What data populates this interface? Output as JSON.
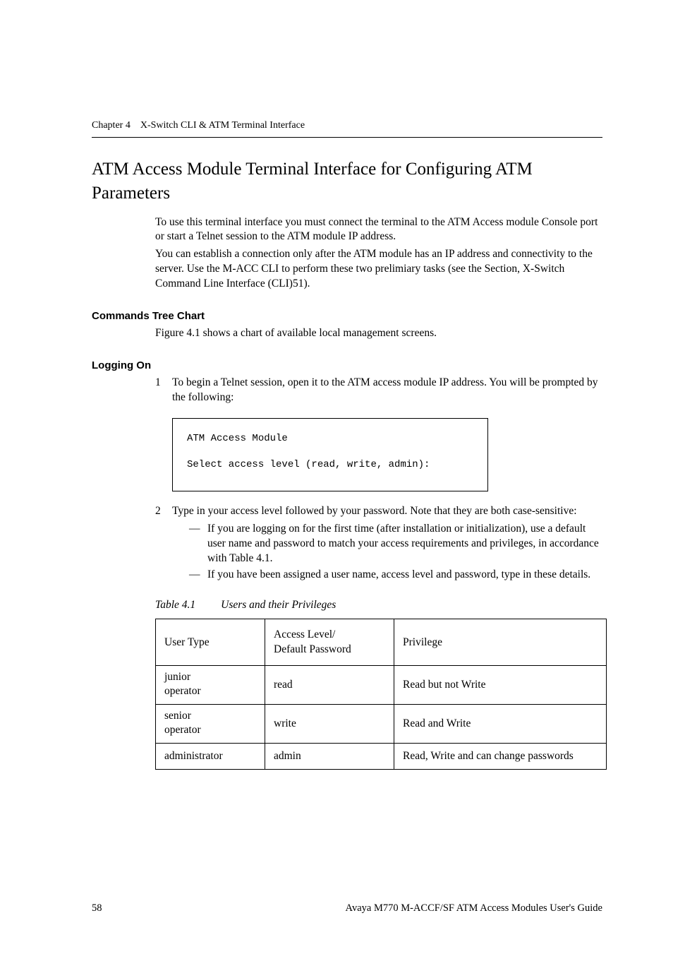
{
  "running_head": {
    "chapter": "Chapter 4",
    "title": "X-Switch CLI & ATM Terminal Interface"
  },
  "section_title": "ATM Access Module Terminal Interface for Configuring ATM Parameters",
  "intro": {
    "p1": "To use this terminal interface you must connect the terminal to the ATM Access module Console port or start a Telnet session to the ATM module IP address.",
    "p2": "You can establish a connection only after the ATM module has an IP address and connectivity to the server. Use the M-ACC CLI to perform these two prelimiary tasks (see the Section, X-Switch Command Line Interface (CLI)51)."
  },
  "commands_tree": {
    "heading": "Commands Tree Chart",
    "text": "Figure 4.1 shows a chart of available local management screens."
  },
  "logging_on": {
    "heading": "Logging On",
    "steps": [
      {
        "num": "1",
        "text": "To begin a Telnet session, open it to the ATM access module IP address. You will be prompted by the following:"
      },
      {
        "num": "2",
        "text": "Type in your access level followed by your password. Note that they are both case-sensitive:"
      }
    ],
    "terminal": {
      "line1": "ATM Access Module",
      "line2": "Select access level (read, write, admin):"
    },
    "bullets": [
      "If you are logging on for the first time (after installation or initialization), use a default user name and password to match your access requirements and privileges, in accordance with Table 4.1.",
      "If you have been assigned a user name, access level and password, type in these details."
    ]
  },
  "table": {
    "caption_label": "Table 4.1",
    "caption_text": "Users and their Privileges",
    "headers": {
      "c1": "User Type",
      "c2a": "Access Level/",
      "c2b": "Default Password",
      "c3": "Privilege"
    },
    "rows": [
      {
        "c1a": "junior",
        "c1b": "operator",
        "c2": "read",
        "c3": "Read but not Write"
      },
      {
        "c1a": "senior",
        "c1b": "operator",
        "c2": "write",
        "c3": "Read and Write"
      },
      {
        "c1": "administrator",
        "c2": "admin",
        "c3": "Read, Write and can change passwords"
      }
    ]
  },
  "footer": {
    "page": "58",
    "doc": "Avaya M770 M-ACCF/SF ATM Access Modules User's Guide"
  },
  "chart_data": [
    {
      "type": "table",
      "title": "Users and their Privileges",
      "columns": [
        "User Type",
        "Access Level/Default Password",
        "Privilege"
      ],
      "rows": [
        [
          "junior operator",
          "read",
          "Read but not Write"
        ],
        [
          "senior operator",
          "write",
          "Read and Write"
        ],
        [
          "administrator",
          "admin",
          "Read, Write and can change passwords"
        ]
      ]
    }
  ]
}
